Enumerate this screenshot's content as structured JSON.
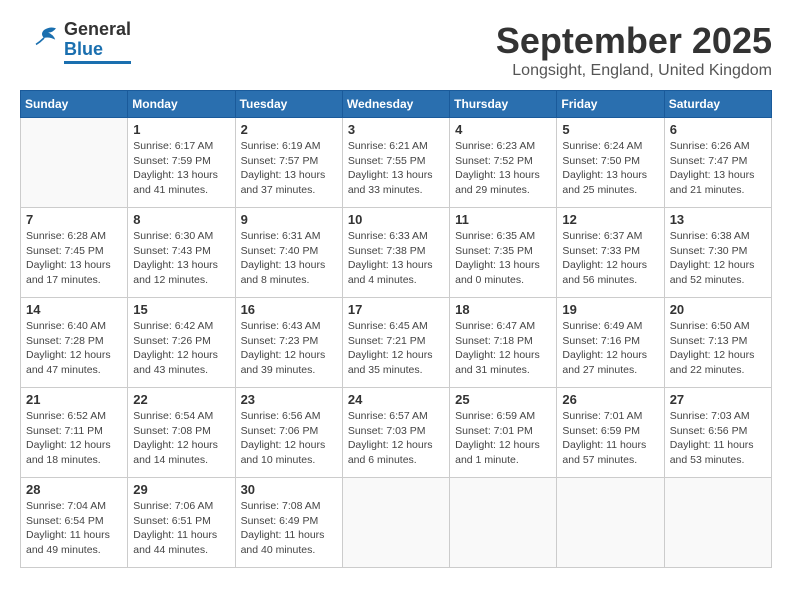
{
  "header": {
    "logo_general": "General",
    "logo_blue": "Blue",
    "month_title": "September 2025",
    "location": "Longsight, England, United Kingdom"
  },
  "weekdays": [
    "Sunday",
    "Monday",
    "Tuesday",
    "Wednesday",
    "Thursday",
    "Friday",
    "Saturday"
  ],
  "weeks": [
    [
      {
        "day": "",
        "sunrise": "",
        "sunset": "",
        "daylight": ""
      },
      {
        "day": "1",
        "sunrise": "Sunrise: 6:17 AM",
        "sunset": "Sunset: 7:59 PM",
        "daylight": "Daylight: 13 hours and 41 minutes."
      },
      {
        "day": "2",
        "sunrise": "Sunrise: 6:19 AM",
        "sunset": "Sunset: 7:57 PM",
        "daylight": "Daylight: 13 hours and 37 minutes."
      },
      {
        "day": "3",
        "sunrise": "Sunrise: 6:21 AM",
        "sunset": "Sunset: 7:55 PM",
        "daylight": "Daylight: 13 hours and 33 minutes."
      },
      {
        "day": "4",
        "sunrise": "Sunrise: 6:23 AM",
        "sunset": "Sunset: 7:52 PM",
        "daylight": "Daylight: 13 hours and 29 minutes."
      },
      {
        "day": "5",
        "sunrise": "Sunrise: 6:24 AM",
        "sunset": "Sunset: 7:50 PM",
        "daylight": "Daylight: 13 hours and 25 minutes."
      },
      {
        "day": "6",
        "sunrise": "Sunrise: 6:26 AM",
        "sunset": "Sunset: 7:47 PM",
        "daylight": "Daylight: 13 hours and 21 minutes."
      }
    ],
    [
      {
        "day": "7",
        "sunrise": "Sunrise: 6:28 AM",
        "sunset": "Sunset: 7:45 PM",
        "daylight": "Daylight: 13 hours and 17 minutes."
      },
      {
        "day": "8",
        "sunrise": "Sunrise: 6:30 AM",
        "sunset": "Sunset: 7:43 PM",
        "daylight": "Daylight: 13 hours and 12 minutes."
      },
      {
        "day": "9",
        "sunrise": "Sunrise: 6:31 AM",
        "sunset": "Sunset: 7:40 PM",
        "daylight": "Daylight: 13 hours and 8 minutes."
      },
      {
        "day": "10",
        "sunrise": "Sunrise: 6:33 AM",
        "sunset": "Sunset: 7:38 PM",
        "daylight": "Daylight: 13 hours and 4 minutes."
      },
      {
        "day": "11",
        "sunrise": "Sunrise: 6:35 AM",
        "sunset": "Sunset: 7:35 PM",
        "daylight": "Daylight: 13 hours and 0 minutes."
      },
      {
        "day": "12",
        "sunrise": "Sunrise: 6:37 AM",
        "sunset": "Sunset: 7:33 PM",
        "daylight": "Daylight: 12 hours and 56 minutes."
      },
      {
        "day": "13",
        "sunrise": "Sunrise: 6:38 AM",
        "sunset": "Sunset: 7:30 PM",
        "daylight": "Daylight: 12 hours and 52 minutes."
      }
    ],
    [
      {
        "day": "14",
        "sunrise": "Sunrise: 6:40 AM",
        "sunset": "Sunset: 7:28 PM",
        "daylight": "Daylight: 12 hours and 47 minutes."
      },
      {
        "day": "15",
        "sunrise": "Sunrise: 6:42 AM",
        "sunset": "Sunset: 7:26 PM",
        "daylight": "Daylight: 12 hours and 43 minutes."
      },
      {
        "day": "16",
        "sunrise": "Sunrise: 6:43 AM",
        "sunset": "Sunset: 7:23 PM",
        "daylight": "Daylight: 12 hours and 39 minutes."
      },
      {
        "day": "17",
        "sunrise": "Sunrise: 6:45 AM",
        "sunset": "Sunset: 7:21 PM",
        "daylight": "Daylight: 12 hours and 35 minutes."
      },
      {
        "day": "18",
        "sunrise": "Sunrise: 6:47 AM",
        "sunset": "Sunset: 7:18 PM",
        "daylight": "Daylight: 12 hours and 31 minutes."
      },
      {
        "day": "19",
        "sunrise": "Sunrise: 6:49 AM",
        "sunset": "Sunset: 7:16 PM",
        "daylight": "Daylight: 12 hours and 27 minutes."
      },
      {
        "day": "20",
        "sunrise": "Sunrise: 6:50 AM",
        "sunset": "Sunset: 7:13 PM",
        "daylight": "Daylight: 12 hours and 22 minutes."
      }
    ],
    [
      {
        "day": "21",
        "sunrise": "Sunrise: 6:52 AM",
        "sunset": "Sunset: 7:11 PM",
        "daylight": "Daylight: 12 hours and 18 minutes."
      },
      {
        "day": "22",
        "sunrise": "Sunrise: 6:54 AM",
        "sunset": "Sunset: 7:08 PM",
        "daylight": "Daylight: 12 hours and 14 minutes."
      },
      {
        "day": "23",
        "sunrise": "Sunrise: 6:56 AM",
        "sunset": "Sunset: 7:06 PM",
        "daylight": "Daylight: 12 hours and 10 minutes."
      },
      {
        "day": "24",
        "sunrise": "Sunrise: 6:57 AM",
        "sunset": "Sunset: 7:03 PM",
        "daylight": "Daylight: 12 hours and 6 minutes."
      },
      {
        "day": "25",
        "sunrise": "Sunrise: 6:59 AM",
        "sunset": "Sunset: 7:01 PM",
        "daylight": "Daylight: 12 hours and 1 minute."
      },
      {
        "day": "26",
        "sunrise": "Sunrise: 7:01 AM",
        "sunset": "Sunset: 6:59 PM",
        "daylight": "Daylight: 11 hours and 57 minutes."
      },
      {
        "day": "27",
        "sunrise": "Sunrise: 7:03 AM",
        "sunset": "Sunset: 6:56 PM",
        "daylight": "Daylight: 11 hours and 53 minutes."
      }
    ],
    [
      {
        "day": "28",
        "sunrise": "Sunrise: 7:04 AM",
        "sunset": "Sunset: 6:54 PM",
        "daylight": "Daylight: 11 hours and 49 minutes."
      },
      {
        "day": "29",
        "sunrise": "Sunrise: 7:06 AM",
        "sunset": "Sunset: 6:51 PM",
        "daylight": "Daylight: 11 hours and 44 minutes."
      },
      {
        "day": "30",
        "sunrise": "Sunrise: 7:08 AM",
        "sunset": "Sunset: 6:49 PM",
        "daylight": "Daylight: 11 hours and 40 minutes."
      },
      {
        "day": "",
        "sunrise": "",
        "sunset": "",
        "daylight": ""
      },
      {
        "day": "",
        "sunrise": "",
        "sunset": "",
        "daylight": ""
      },
      {
        "day": "",
        "sunrise": "",
        "sunset": "",
        "daylight": ""
      },
      {
        "day": "",
        "sunrise": "",
        "sunset": "",
        "daylight": ""
      }
    ]
  ]
}
